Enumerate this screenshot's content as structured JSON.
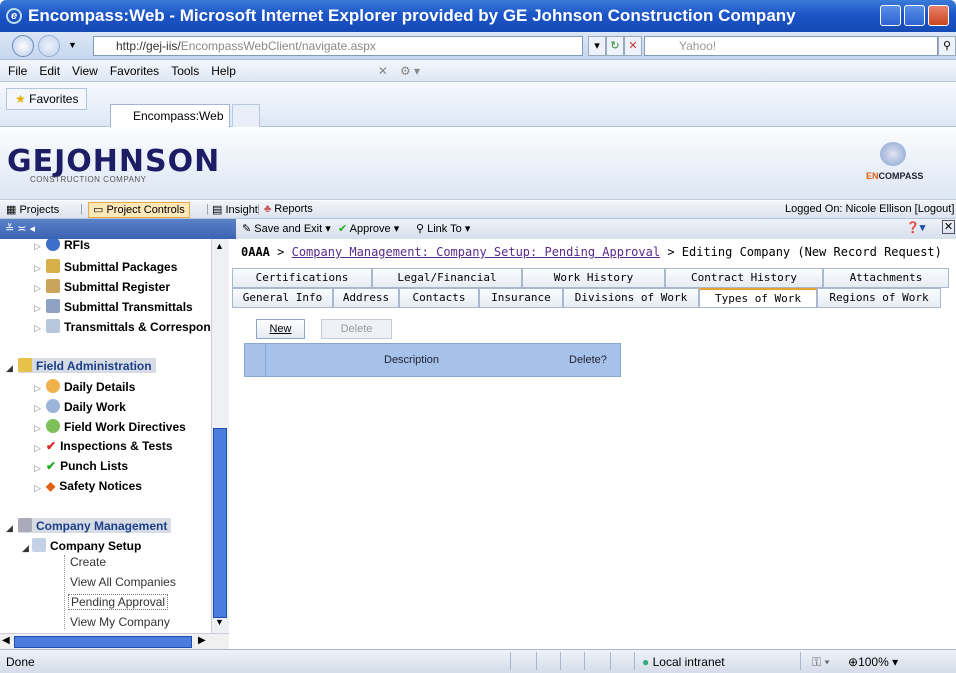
{
  "window": {
    "title": "Encompass:Web - Microsoft Internet Explorer provided by GE Johnson Construction Company"
  },
  "address": {
    "url_prefix": "http://gej-iis/",
    "url_rest": "EncompassWebClient/navigate.aspx",
    "search_placeholder": "Yahoo!"
  },
  "menu": [
    "File",
    "Edit",
    "View",
    "Favorites",
    "Tools",
    "Help"
  ],
  "favorites": {
    "label": "Favorites",
    "tab": "Encompass:Web"
  },
  "brand": {
    "logo": "GEJOHNSON",
    "logo_sub": "CONSTRUCTION COMPANY",
    "product_a": "EN",
    "product_b": "COMPASS"
  },
  "nav": {
    "projects": "Projects",
    "project_controls": "Project Controls",
    "insight": "Insight",
    "reports": "Reports",
    "logged_on": "Logged On: Nicole Ellison",
    "logout": "[Logout]"
  },
  "toolbar": {
    "save_exit": "Save and Exit",
    "approve": "Approve",
    "link_to": "Link To"
  },
  "sidebar": {
    "items": [
      {
        "label": "RFIs"
      },
      {
        "label": "Submittal Packages"
      },
      {
        "label": "Submittal Register"
      },
      {
        "label": "Submittal Transmittals"
      },
      {
        "label": "Transmittals & Correspond"
      }
    ],
    "field_admin": "Field Administration",
    "field_items": [
      {
        "label": "Daily Details"
      },
      {
        "label": "Daily Work"
      },
      {
        "label": "Field Work Directives"
      },
      {
        "label": "Inspections & Tests"
      },
      {
        "label": "Punch Lists"
      },
      {
        "label": "Safety Notices"
      }
    ],
    "company_mgmt": "Company Management",
    "company_setup": "Company Setup",
    "setup_items": [
      {
        "label": "Create"
      },
      {
        "label": "View All Companies"
      },
      {
        "label": "Pending Approval"
      },
      {
        "label": "View My Company"
      }
    ]
  },
  "breadcrumb": {
    "root": "0AAA",
    "sep": ">",
    "link": "Company Management: Company Setup: Pending Approval",
    "current": "Editing Company (New Record Request)"
  },
  "tabs_top": [
    "Certifications",
    "Legal/Financial",
    "Work History",
    "Contract History",
    "Attachments"
  ],
  "tabs_bottom": [
    "General Info",
    "Address",
    "Contacts",
    "Insurance",
    "Divisions of Work",
    "Types of Work",
    "Regions of Work"
  ],
  "buttons": {
    "new": "New",
    "delete": "Delete"
  },
  "grid": {
    "columns": [
      "Description",
      "Delete?"
    ]
  },
  "status": {
    "left": "Done",
    "zone": "Local intranet",
    "zoom": "100%"
  },
  "colors": {
    "titlebar": "#1d55c7",
    "accent": "#e8a030",
    "grid_header": "#a7c2ea",
    "link": "#5a2a8a"
  }
}
